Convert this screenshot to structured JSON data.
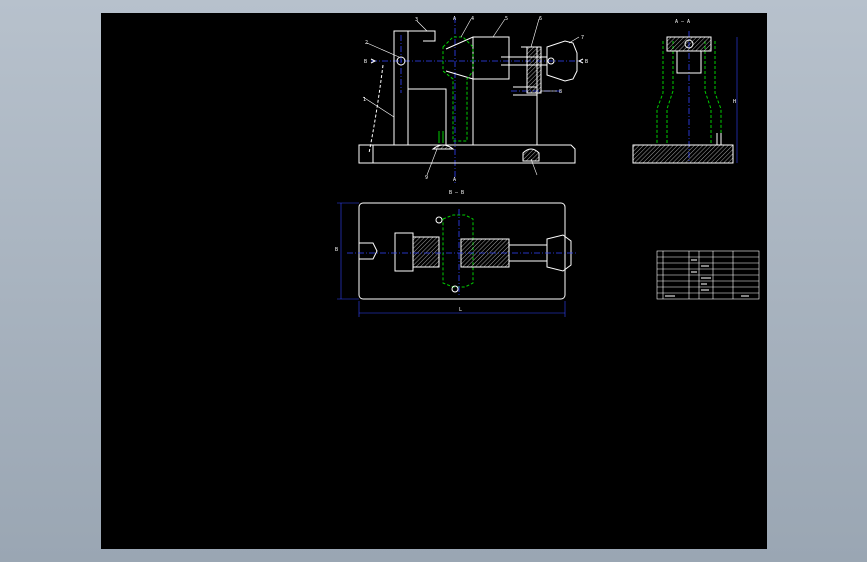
{
  "labels": {
    "front_view": {
      "balloons": [
        "1",
        "2",
        "3",
        "4",
        "5",
        "6",
        "7",
        "8",
        "9"
      ],
      "section_mark": "B",
      "centre_mark": "A"
    },
    "side_view": {
      "title": "A — A"
    },
    "top_view": {
      "title": "B — B"
    },
    "dimensions": {
      "height": "H",
      "width": "B",
      "length": "L"
    }
  },
  "colors": {
    "background": "#000000",
    "outline": "#ffffff",
    "hidden": "#00cc00",
    "center": "#3344ff",
    "hatch": "#cccccc"
  }
}
